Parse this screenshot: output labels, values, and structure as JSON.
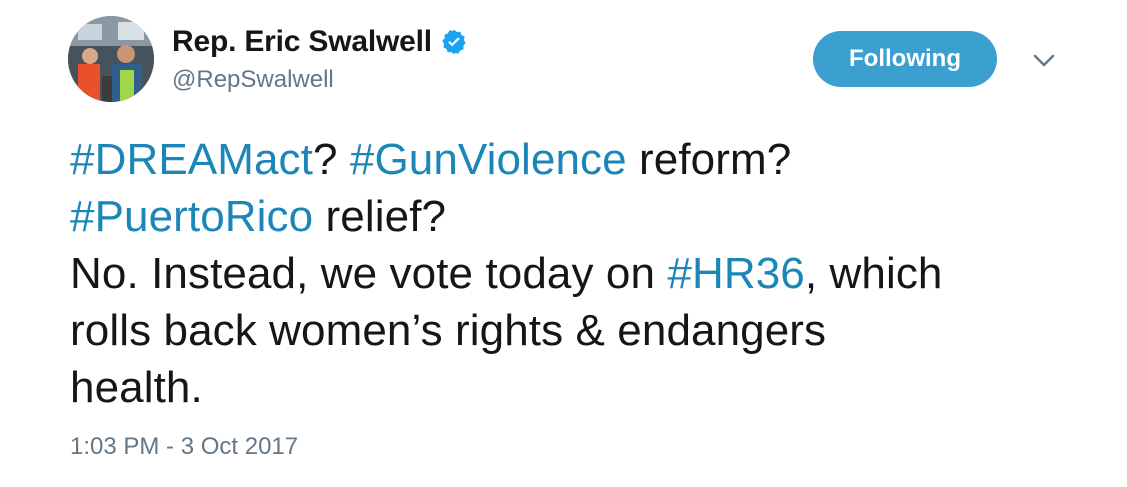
{
  "tweet": {
    "author": {
      "display_name": "Rep. Eric Swalwell",
      "handle": "@RepSwalwell",
      "verified": true
    },
    "follow_button_label": "Following",
    "text_lines": [
      [
        {
          "type": "hashtag",
          "text": "#DREAMact"
        },
        {
          "type": "text",
          "text": "? "
        },
        {
          "type": "hashtag",
          "text": "#GunViolence"
        },
        {
          "type": "text",
          "text": " reform?"
        }
      ],
      [
        {
          "type": "hashtag",
          "text": "#PuertoRico"
        },
        {
          "type": "text",
          "text": " relief?"
        }
      ],
      [
        {
          "type": "text",
          "text": "No. Instead, we vote today on "
        },
        {
          "type": "hashtag",
          "text": "#HR36"
        },
        {
          "type": "text",
          "text": ", which"
        }
      ],
      [
        {
          "type": "text",
          "text": "rolls back women’s rights & endangers"
        }
      ],
      [
        {
          "type": "text",
          "text": "health."
        }
      ]
    ],
    "timestamp": "1:03 PM - 3 Oct 2017"
  },
  "colors": {
    "hashtag": "#1b86b7",
    "follow_button_bg": "#3b9fd0",
    "verified_badge": "#1da1f2",
    "secondary_text": "#657786"
  },
  "icons": {
    "verified": "verified-badge-icon",
    "caret": "chevron-down-icon"
  }
}
